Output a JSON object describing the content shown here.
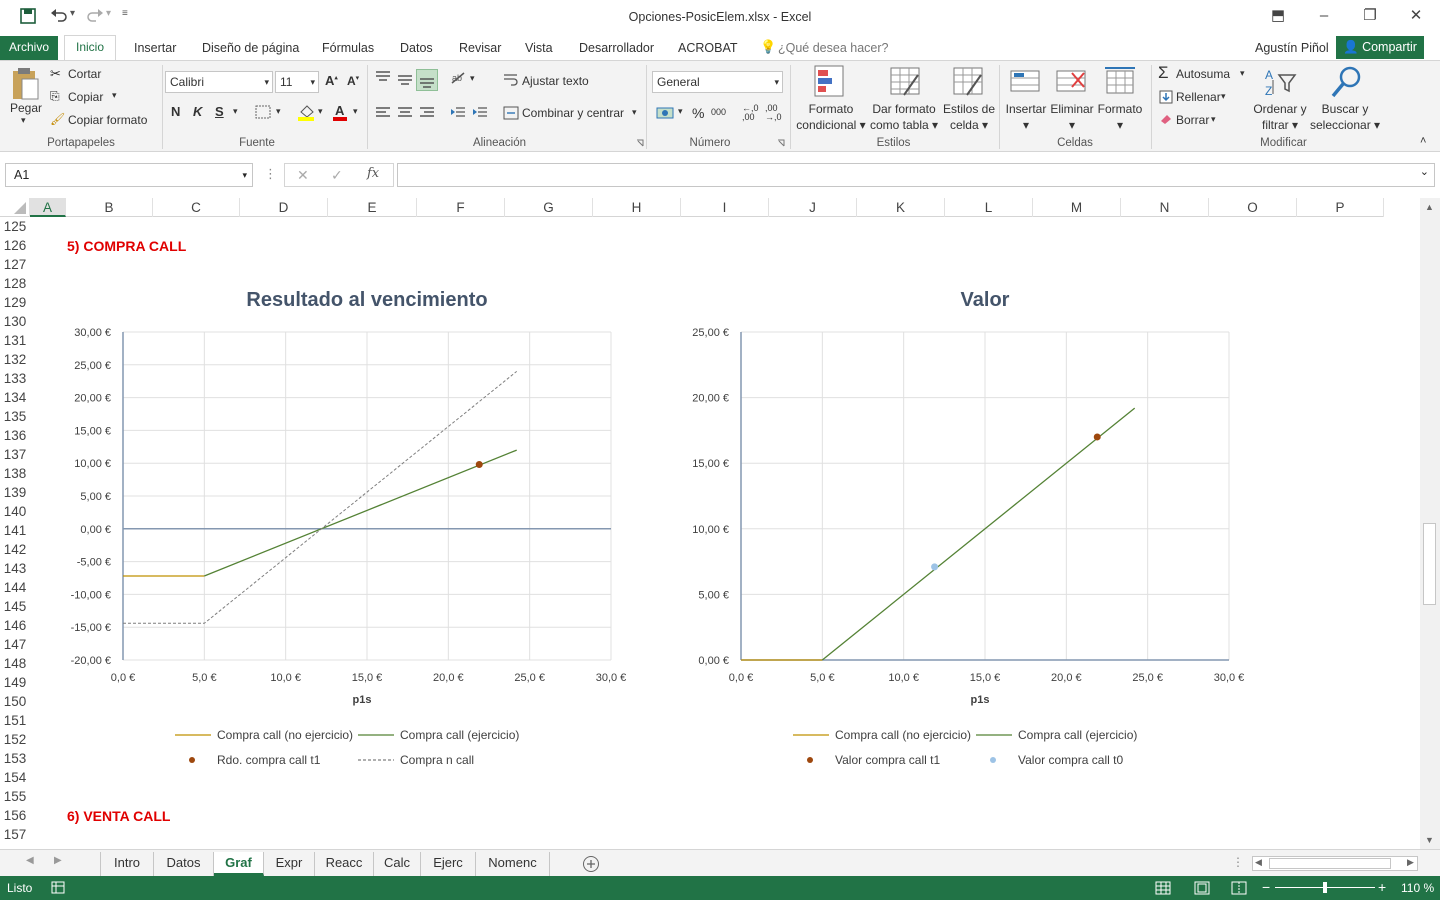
{
  "window": {
    "title": "Opciones-PosicElem.xlsx - Excel"
  },
  "menu": {
    "archivo": "Archivo",
    "tabs": [
      "Inicio",
      "Insertar",
      "Diseño de página",
      "Fórmulas",
      "Datos",
      "Revisar",
      "Vista",
      "Desarrollador",
      "ACROBAT"
    ],
    "search_placeholder": "¿Qué desea hacer?",
    "user": "Agustín Piñol",
    "share": "Compartir"
  },
  "ribbon": {
    "clipboard": {
      "paste": "Pegar",
      "cut": "Cortar",
      "copy": "Copiar",
      "format_painter": "Copiar formato",
      "group": "Portapapeles"
    },
    "font": {
      "name": "Calibri",
      "size": "11",
      "bold": "N",
      "italic": "K",
      "underline": "S",
      "group": "Fuente"
    },
    "alignment": {
      "wrap": "Ajustar texto",
      "merge": "Combinar y centrar",
      "group": "Alineación"
    },
    "number": {
      "format": "General",
      "group": "Número"
    },
    "styles": {
      "conditional": [
        "Formato",
        "condicional"
      ],
      "table": [
        "Dar formato",
        "como tabla"
      ],
      "cell": [
        "Estilos de",
        "celda"
      ],
      "group": "Estilos"
    },
    "cells": {
      "insert": "Insertar",
      "delete": "Eliminar",
      "format": "Formato",
      "group": "Celdas"
    },
    "editing": {
      "autosum": "Autosuma",
      "fill": "Rellenar",
      "clear": "Borrar",
      "sort": [
        "Ordenar y",
        "filtrar"
      ],
      "find": [
        "Buscar y",
        "seleccionar"
      ],
      "group": "Modificar"
    }
  },
  "formula_bar": {
    "name_box": "A1",
    "formula": ""
  },
  "grid": {
    "columns": [
      "A",
      "B",
      "C",
      "D",
      "E",
      "F",
      "G",
      "H",
      "I",
      "J",
      "K",
      "L",
      "M",
      "N",
      "O",
      "P"
    ],
    "rows": [
      "125",
      "126",
      "127",
      "128",
      "129",
      "130",
      "131",
      "132",
      "133",
      "134",
      "135",
      "136",
      "137",
      "138",
      "139",
      "140",
      "141",
      "142",
      "143",
      "144",
      "145",
      "146",
      "147",
      "148",
      "149",
      "150",
      "151",
      "152",
      "153",
      "154",
      "155",
      "156",
      "157"
    ]
  },
  "content": {
    "section1": "5) COMPRA CALL",
    "section2": "6) VENTA CALL"
  },
  "chart_data": [
    {
      "type": "line",
      "title": "Resultado al vencimiento",
      "xlabel": "p1s",
      "ylabel": "",
      "xlim": [
        0,
        30
      ],
      "ylim": [
        -20,
        30
      ],
      "x_ticks": [
        "0,0 €",
        "5,0 €",
        "10,0 €",
        "15,0 €",
        "20,0 €",
        "25,0 €",
        "30,0 €"
      ],
      "y_ticks": [
        "-20,00 €",
        "-15,00 €",
        "-10,00 €",
        "-5,00 €",
        "0,00 €",
        "5,00 €",
        "10,00 €",
        "15,00 €",
        "20,00 €",
        "25,00 €",
        "30,00 €"
      ],
      "grid": true,
      "legend_position": "bottom",
      "series": [
        {
          "name": "Compra call (no ejercicio)",
          "kind": "line",
          "color": "#bf9000",
          "points": [
            [
              0,
              -7.2
            ],
            [
              5,
              -7.2
            ]
          ]
        },
        {
          "name": "Compra call (ejercicio)",
          "kind": "line",
          "color": "#548235",
          "points": [
            [
              5,
              -7.2
            ],
            [
              24.2,
              12.0
            ]
          ]
        },
        {
          "name": "Rdo. compra call t1",
          "kind": "marker",
          "color": "#9e480e",
          "points": [
            [
              21.9,
              9.8
            ]
          ]
        },
        {
          "name": "Compra n call",
          "kind": "dashed",
          "color": "#7f7f7f",
          "points": [
            [
              0,
              -14.4
            ],
            [
              5,
              -14.4
            ],
            [
              24.2,
              24.0
            ]
          ]
        }
      ]
    },
    {
      "type": "line",
      "title": "Valor",
      "xlabel": "p1s",
      "ylabel": "",
      "xlim": [
        0,
        30
      ],
      "ylim": [
        0,
        25
      ],
      "x_ticks": [
        "0,0 €",
        "5,0 €",
        "10,0 €",
        "15,0 €",
        "20,0 €",
        "25,0 €",
        "30,0 €"
      ],
      "y_ticks": [
        "0,00 €",
        "5,00 €",
        "10,00 €",
        "15,00 €",
        "20,00 €",
        "25,00 €"
      ],
      "grid": true,
      "legend_position": "bottom",
      "series": [
        {
          "name": "Compra call (no ejercicio)",
          "kind": "line",
          "color": "#bf9000",
          "points": [
            [
              0,
              0
            ],
            [
              5,
              0
            ]
          ]
        },
        {
          "name": "Compra call (ejercicio)",
          "kind": "line",
          "color": "#548235",
          "points": [
            [
              5,
              0
            ],
            [
              24.2,
              19.2
            ]
          ]
        },
        {
          "name": "Valor compra call t1",
          "kind": "marker",
          "color": "#9e480e",
          "points": [
            [
              21.9,
              17.0
            ]
          ]
        },
        {
          "name": "Valor compra call t0",
          "kind": "marker",
          "color": "#9dc3e6",
          "points": [
            [
              11.9,
              7.1
            ]
          ]
        }
      ]
    }
  ],
  "sheet_tabs": {
    "tabs": [
      "Intro",
      "Datos",
      "Graf",
      "Expr",
      "Reacc",
      "Calc",
      "Ejerc",
      "Nomenc"
    ],
    "active": "Graf"
  },
  "status": {
    "mode": "Listo",
    "zoom": "110 %"
  },
  "colors": {
    "accent": "#217346",
    "section_title": "#e00000",
    "chart_title": "#44546a"
  }
}
